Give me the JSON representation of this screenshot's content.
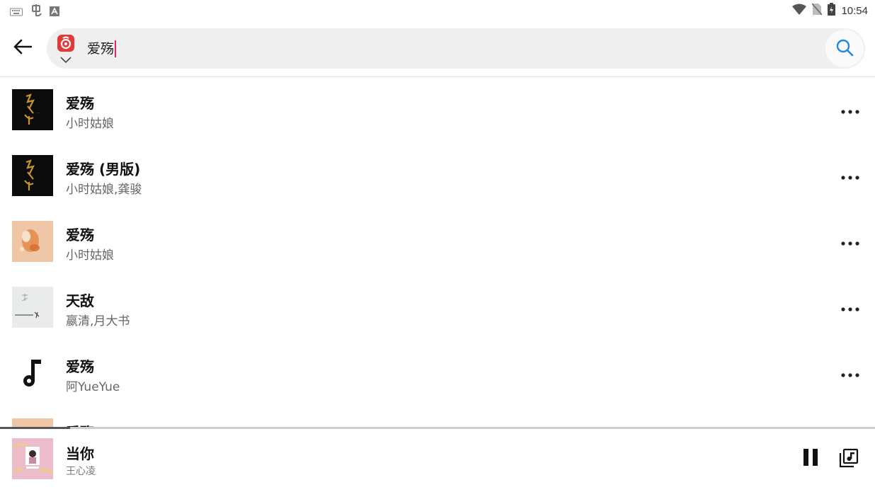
{
  "status_bar": {
    "time": "10:54"
  },
  "search": {
    "query": "爱殇"
  },
  "results": [
    {
      "title": "爱殇",
      "artist": "小时姑娘",
      "cover": "dark-calligraphy"
    },
    {
      "title": "爱殇 (男版)",
      "artist": "小时姑娘,龚骏",
      "cover": "dark-calligraphy"
    },
    {
      "title": "爱殇",
      "artist": "小时姑娘",
      "cover": "orange-floral"
    },
    {
      "title": "天敌",
      "artist": "嬴清,月大书",
      "cover": "light-ink"
    },
    {
      "title": "爱殇",
      "artist": "阿YueYue",
      "cover": "music-note-icon"
    },
    {
      "title": "爱殇",
      "artist": "",
      "cover": "orange-floral"
    }
  ],
  "now_playing": {
    "title": "当你",
    "artist": "王心凌",
    "progress": 0.08
  },
  "colors": {
    "accent_search": "#1e88e5",
    "source_logo": "#e53935",
    "cursor": "#e0245e"
  }
}
